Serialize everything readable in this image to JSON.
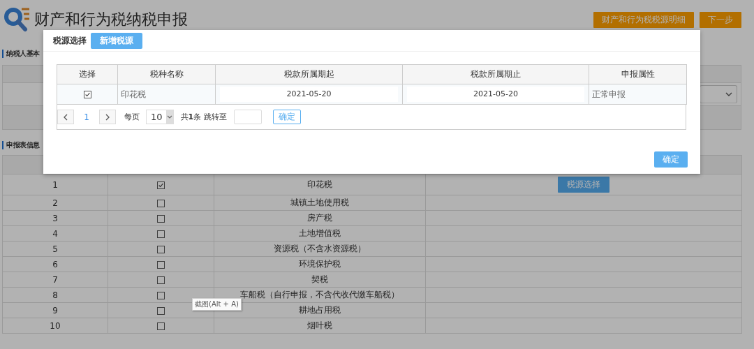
{
  "page": {
    "title": "财产和行为税纳税申报",
    "actions": [
      "财产和行为税税源明细",
      "下一步"
    ]
  },
  "taxpayer_section": {
    "title": "纳税人基本"
  },
  "declaration_section": {
    "title": "申报表信息",
    "rows": [
      {
        "index": "1",
        "checked": true,
        "tax_name": "印花税",
        "action": "税源选择"
      },
      {
        "index": "2",
        "checked": false,
        "tax_name": "城镇土地使用税"
      },
      {
        "index": "3",
        "checked": false,
        "tax_name": "房产税"
      },
      {
        "index": "4",
        "checked": false,
        "tax_name": "土地增值税"
      },
      {
        "index": "5",
        "checked": false,
        "tax_name": "资源税（不含水资源税）"
      },
      {
        "index": "6",
        "checked": false,
        "tax_name": "环境保护税"
      },
      {
        "index": "7",
        "checked": false,
        "tax_name": "契税"
      },
      {
        "index": "8",
        "checked": false,
        "tax_name": "车船税（自行申报，不含代收代缴车船税）"
      },
      {
        "index": "9",
        "checked": false,
        "tax_name": "耕地占用税"
      },
      {
        "index": "10",
        "checked": false,
        "tax_name": "烟叶税"
      }
    ]
  },
  "modal": {
    "title": "税源选择",
    "add_button": "新增税源",
    "table": {
      "columns": [
        "选择",
        "税种名称",
        "税款所属期起",
        "税款所属期止",
        "申报属性"
      ],
      "rows": [
        {
          "checked": true,
          "tax_name": "印花税",
          "period_start": "2021-05-20",
          "period_end": "2021-05-20",
          "attribute": "正常申报"
        }
      ]
    },
    "pagination": {
      "page": "1",
      "per_page_label": "每页",
      "page_size": "10",
      "total": "共**1**条 跳转至",
      "go_button": "确定"
    },
    "confirm_button": "确定"
  },
  "tooltip": "截图(Alt + A)"
}
